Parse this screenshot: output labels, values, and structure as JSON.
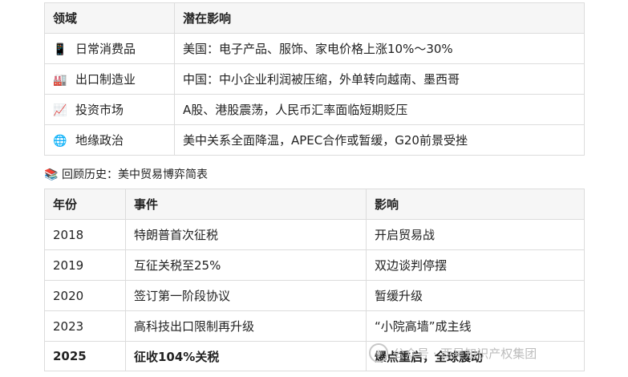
{
  "impact_table": {
    "headers": [
      "领域",
      "潜在影响"
    ],
    "rows": [
      {
        "icon": "mobile-phone-icon",
        "glyph": "📱",
        "domain": "日常消费品",
        "impact": "美国：电子产品、服饰、家电价格上涨10%～30%"
      },
      {
        "icon": "factory-icon",
        "glyph": "🏭",
        "domain": "出口制造业",
        "impact": "中国：中小企业利润被压缩，外单转向越南、墨西哥"
      },
      {
        "icon": "chart-increasing-icon",
        "glyph": "📈",
        "domain": "投资市场",
        "impact": "A股、港股震荡，人民币汇率面临短期贬压"
      },
      {
        "icon": "globe-icon",
        "glyph": "🌐",
        "domain": "地缘政治",
        "impact": "美中关系全面降温，APEC合作或暂缓，G20前景受挫"
      }
    ]
  },
  "history_caption": {
    "icon": "books-icon",
    "glyph": "📚",
    "text": "回顾历史：美中贸易博弈简表"
  },
  "history_table": {
    "headers": [
      "年份",
      "事件",
      "影响"
    ],
    "rows": [
      {
        "year": "2018",
        "event": "特朗普首次征税",
        "impact": "开启贸易战"
      },
      {
        "year": "2019",
        "event": "互征关税至25%",
        "impact": "双边谈判停摆"
      },
      {
        "year": "2020",
        "event": "签订第一阶段协议",
        "impact": "暂缓升级"
      },
      {
        "year": "2023",
        "event": "高科技出口限制再升级",
        "impact": "“小院高墙”成主线"
      },
      {
        "year": "2025",
        "event": "征收104%关税",
        "impact": "爆点重启，全球震动"
      }
    ]
  },
  "watermark": {
    "text": "公众号 · 西吴知识产权集团"
  }
}
